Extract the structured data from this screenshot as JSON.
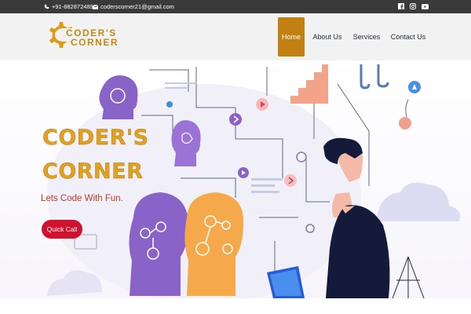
{
  "topbar": {
    "phone": "+91-8828724893",
    "email": "coderscorner21@gmail.com",
    "icons": [
      "phone-icon",
      "mail-icon",
      "facebook-icon",
      "instagram-icon",
      "youtube-icon"
    ]
  },
  "header": {
    "logo": {
      "line1": "CODER'S",
      "line2": "CORNER",
      "icon": "gear-icon"
    },
    "nav": [
      {
        "label": "Home",
        "active": true
      },
      {
        "label": "About Us",
        "active": false
      },
      {
        "label": "Services",
        "active": false
      },
      {
        "label": "Contact Us",
        "active": false
      }
    ]
  },
  "hero": {
    "title_line1": "CODER'S",
    "title_line2": "CORNER",
    "tagline": "Lets Code With Fun.",
    "cta_label": "Quick Call"
  },
  "colors": {
    "topbar_bg": "#3a3a3a",
    "header_bg": "#f2f2f2",
    "accent": "#c08012",
    "title": "#e0a020",
    "cta": "#d0122e",
    "tagline": "#c0392b"
  }
}
